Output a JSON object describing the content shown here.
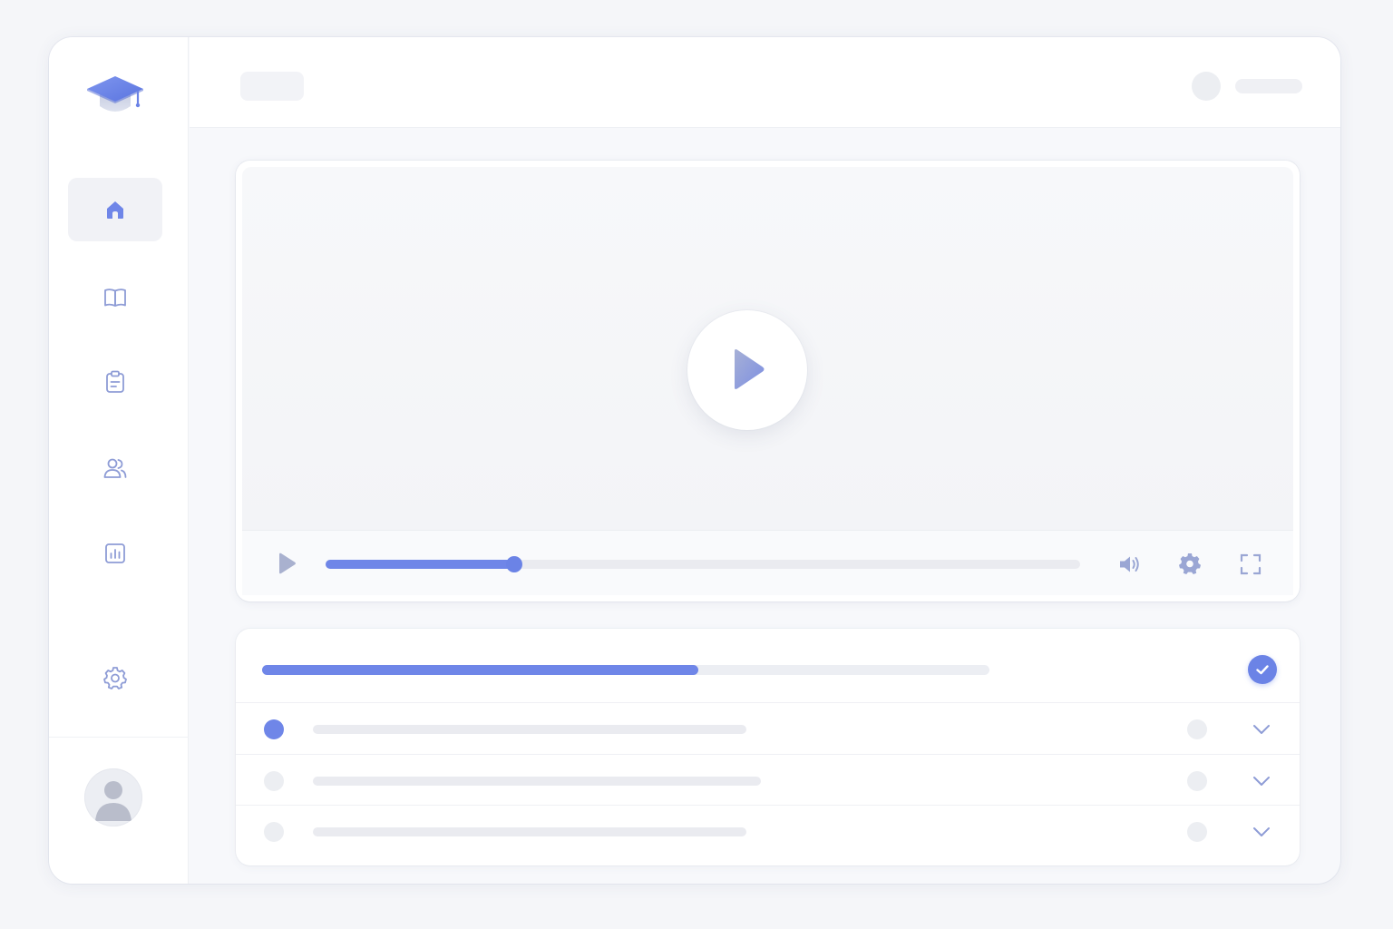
{
  "colors": {
    "accent": "#6b83e6",
    "accent_light": "#8fa2ee",
    "icon_muted": "#8e9cd6",
    "placeholder": "#eaebf0",
    "background": "#f5f6f9"
  },
  "sidebar": {
    "logo_icon": "graduation-cap-icon",
    "nav_items": [
      {
        "icon": "home-icon",
        "active": true
      },
      {
        "icon": "book-icon",
        "active": false
      },
      {
        "icon": "clipboard-icon",
        "active": false
      },
      {
        "icon": "users-icon",
        "active": false
      },
      {
        "icon": "bar-chart-icon",
        "active": false
      }
    ],
    "settings_icon": "gear-icon",
    "profile_icon": "user-avatar-icon"
  },
  "video_player": {
    "center_icon": "play-icon",
    "progress": 0.25,
    "controls": [
      "play-icon",
      "volume-icon",
      "gear-icon",
      "fullscreen-icon"
    ]
  },
  "course": {
    "progress": 0.6,
    "completed_icon": "check-icon",
    "lessons": [
      {
        "current": true,
        "title_length": 0.59
      },
      {
        "current": false,
        "title_length": 0.61
      },
      {
        "current": false,
        "title_length": 0.59
      }
    ],
    "expand_icon": "chevron-down-icon"
  }
}
